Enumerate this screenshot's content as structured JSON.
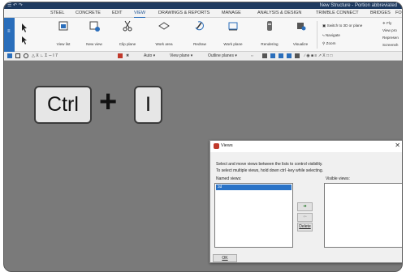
{
  "window": {
    "title": "New Structure - Portion abbreviated",
    "quick_access": "☰ ↶ ↷"
  },
  "tabs": [
    {
      "label": "STEEL"
    },
    {
      "label": "CONCRETE"
    },
    {
      "label": "EDIT"
    },
    {
      "label": "VIEW",
      "active": true
    },
    {
      "label": "DRAWINGS & REPORTS"
    },
    {
      "label": "MANAGE"
    },
    {
      "label": "ANALYSIS & DESIGN"
    },
    {
      "label": "TRIMBLE CONNECT"
    },
    {
      "label": "BRIDGES"
    },
    {
      "label": "FO"
    }
  ],
  "ribbon": {
    "buttons": [
      {
        "label": "View list",
        "icon": "view-list-icon"
      },
      {
        "label": "New view",
        "icon": "new-view-icon"
      },
      {
        "label": "Clip plane",
        "icon": "scissors-icon"
      },
      {
        "label": "Work area",
        "icon": "work-area-icon"
      },
      {
        "label": "Redraw",
        "icon": "redraw-icon"
      },
      {
        "label": "Work plane",
        "icon": "work-plane-icon"
      },
      {
        "label": "Rendering",
        "icon": "rendering-icon"
      },
      {
        "label": "Visualize",
        "icon": "visualize-icon"
      }
    ],
    "switch_label": "Switch to 3D or plane",
    "navigate_label": "Navigate",
    "zoom_label": "Zoom",
    "fly_label": "Fly",
    "viewpro_label": "View pro",
    "represent_label": "Represen",
    "screenshot_label": "Screensh"
  },
  "toolbar": {
    "auto_label": "Auto ▾",
    "view_plane_label": "View plane ▾",
    "outline_planes_label": "Outline planes ▾"
  },
  "overlay": {
    "key_ctrl": "Ctrl",
    "plus": "+",
    "key_i": "I"
  },
  "dialog": {
    "title": "Views",
    "close": "✕",
    "instruction_line1": "Select and move views between the lists to control visibility.",
    "instruction_line2": "To select multiple views, hold down ctrl -key while selecting.",
    "named_views_label": "Named views:",
    "visible_views_label": "Visible views:",
    "named_items": [
      "3d"
    ],
    "move_right_glyph": "➔",
    "move_left_glyph": "⇦",
    "delete_label": "Delete",
    "ok_label": "OK"
  },
  "colors": {
    "accent": "#2a6ebb",
    "background": "#7a7a7a"
  }
}
